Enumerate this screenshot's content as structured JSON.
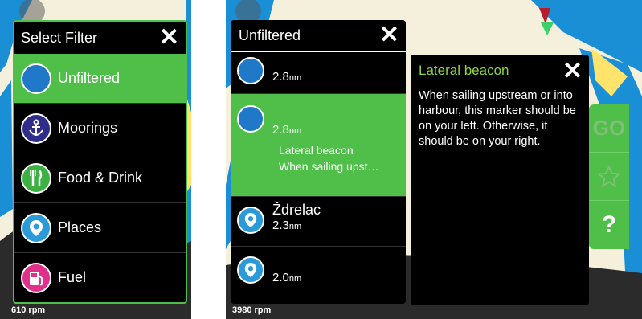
{
  "left": {
    "panel_title": "Select Filter",
    "items": [
      {
        "label": "Unfiltered",
        "icon": "circle-icon",
        "color": "#1f78c8",
        "selected": true
      },
      {
        "label": "Moorings",
        "icon": "anchor-icon",
        "color": "#2e2d8c",
        "selected": false
      },
      {
        "label": "Food & Drink",
        "icon": "fork-knife-icon",
        "color": "#3cb043",
        "selected": false
      },
      {
        "label": "Places",
        "icon": "location-pin-icon",
        "color": "#2a9ad8",
        "selected": false
      },
      {
        "label": "Fuel",
        "icon": "fuel-pump-icon",
        "color": "#e0308a",
        "selected": false
      }
    ],
    "speed_text": "610 rpm"
  },
  "right": {
    "panel_title": "Unfiltered",
    "items": [
      {
        "distance": "2.8",
        "unit": "nm",
        "icon": "circle-icon",
        "color": "#1f78c8"
      },
      {
        "distance": "2.8",
        "unit": "nm",
        "icon": "circle-icon",
        "color": "#1f78c8",
        "name": "Lateral beacon",
        "desc": "When sailing upst…",
        "selected": true
      },
      {
        "name": "Ždrelac",
        "distance": "2.3",
        "unit": "nm",
        "icon": "location-pin-icon",
        "color": "#2a9ad8"
      },
      {
        "distance": "2.0",
        "unit": "nm",
        "icon": "location-pin-icon",
        "color": "#2a9ad8"
      }
    ],
    "info": {
      "title": "Lateral beacon",
      "body": "When sailing upstream or into harbour, this marker should be on your left. Otherwise, it should be on your right."
    },
    "actions": {
      "go": "GO",
      "help": "?"
    },
    "speed_text": "3980 rpm"
  },
  "colors": {
    "accent": "#4fbf4a",
    "map_sea": "#1b8fd6",
    "map_land": "#f6f1de"
  }
}
